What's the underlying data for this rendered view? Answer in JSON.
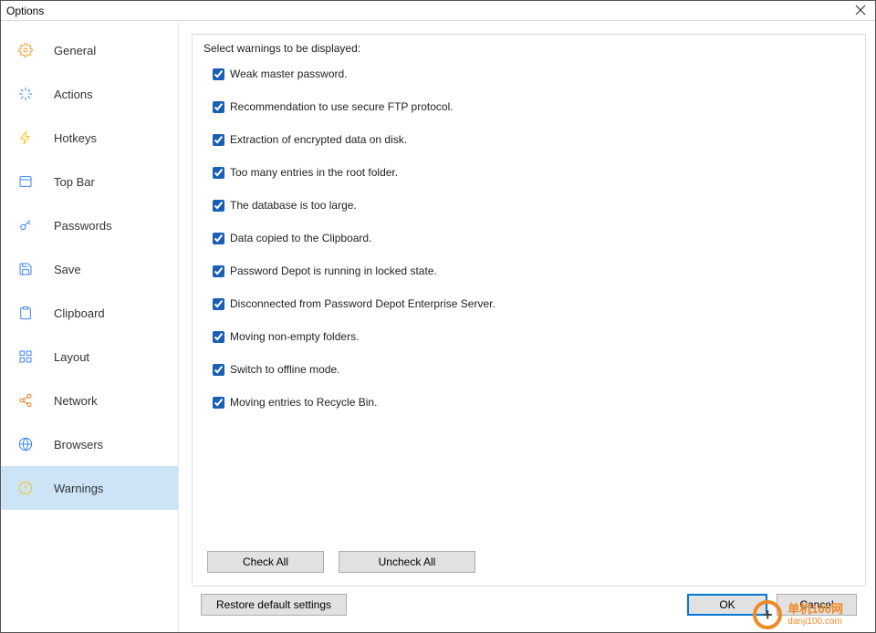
{
  "window": {
    "title": "Options"
  },
  "sidebar": {
    "items": [
      {
        "label": "General",
        "icon": "gear-icon",
        "color": "#f0a030"
      },
      {
        "label": "Actions",
        "icon": "sparkle-icon",
        "color": "#3b82f6"
      },
      {
        "label": "Hotkeys",
        "icon": "bolt-icon",
        "color": "#f5c518"
      },
      {
        "label": "Top Bar",
        "icon": "topbar-icon",
        "color": "#3b82f6"
      },
      {
        "label": "Passwords",
        "icon": "key-icon",
        "color": "#3b82f6"
      },
      {
        "label": "Save",
        "icon": "save-icon",
        "color": "#3b82f6"
      },
      {
        "label": "Clipboard",
        "icon": "clipboard-icon",
        "color": "#3b82f6"
      },
      {
        "label": "Layout",
        "icon": "grid-icon",
        "color": "#3b82f6"
      },
      {
        "label": "Network",
        "icon": "share-icon",
        "color": "#f97316"
      },
      {
        "label": "Browsers",
        "icon": "globe-icon",
        "color": "#3b82f6"
      },
      {
        "label": "Warnings",
        "icon": "warning-icon",
        "color": "#f5c518",
        "active": true
      }
    ]
  },
  "panel": {
    "heading": "Select warnings to be displayed:",
    "warnings": [
      {
        "label": "Weak master password.",
        "checked": true
      },
      {
        "label": "Recommendation to use secure FTP protocol.",
        "checked": true
      },
      {
        "label": "Extraction of encrypted data on disk.",
        "checked": true
      },
      {
        "label": "Too many entries in the root folder.",
        "checked": true
      },
      {
        "label": "The database is too large.",
        "checked": true
      },
      {
        "label": "Data copied to the Clipboard.",
        "checked": true
      },
      {
        "label": "Password Depot is running in locked state.",
        "checked": true
      },
      {
        "label": "Disconnected from Password Depot Enterprise Server.",
        "checked": true
      },
      {
        "label": "Moving non-empty folders.",
        "checked": true
      },
      {
        "label": "Switch to offline mode.",
        "checked": true
      },
      {
        "label": "Moving entries to Recycle Bin.",
        "checked": true
      }
    ],
    "check_all_label": "Check All",
    "uncheck_all_label": "Uncheck All"
  },
  "footer": {
    "restore_label": "Restore default settings",
    "ok_label": "OK",
    "cancel_label": "Cancel"
  },
  "watermark": {
    "cn": "单机100网",
    "domain": "danji100.com"
  }
}
